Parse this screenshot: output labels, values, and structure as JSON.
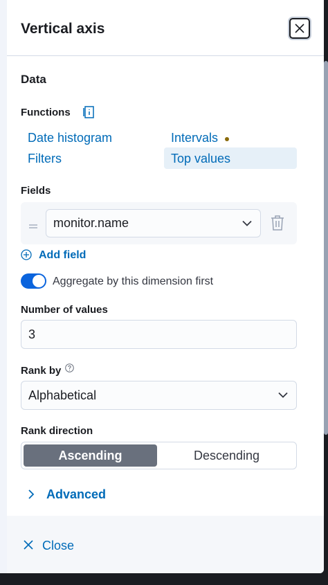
{
  "header": {
    "title": "Vertical axis",
    "close_icon": "close-icon"
  },
  "data_section": {
    "heading": "Data"
  },
  "functions": {
    "label": "Functions",
    "help_icon": "documentation-icon",
    "items": [
      {
        "label": "Date histogram",
        "selected": false
      },
      {
        "label": "Intervals",
        "selected": false,
        "has_indicator": true
      },
      {
        "label": "Filters",
        "selected": false
      },
      {
        "label": "Top values",
        "selected": true
      }
    ]
  },
  "fields": {
    "label": "Fields",
    "items": [
      {
        "value": "monitor.name"
      }
    ],
    "add_label": "Add field"
  },
  "aggregate_toggle": {
    "label": "Aggregate by this dimension first",
    "checked": true
  },
  "number_of_values": {
    "label": "Number of values",
    "value": "3"
  },
  "rank_by": {
    "label": "Rank by",
    "value": "Alphabetical"
  },
  "rank_direction": {
    "label": "Rank direction",
    "options": [
      "Ascending",
      "Descending"
    ],
    "selected": "Ascending"
  },
  "advanced": {
    "label": "Advanced"
  },
  "footer": {
    "close_label": "Close"
  },
  "colors": {
    "accent": "#006bb8",
    "toggle_on": "#0b64dd",
    "segment_selected": "#69707d"
  }
}
